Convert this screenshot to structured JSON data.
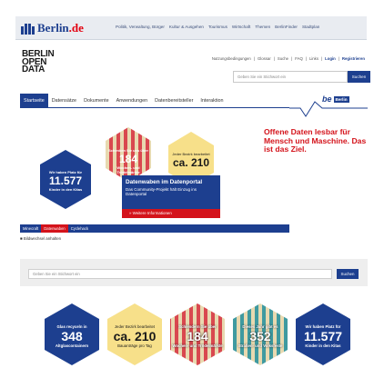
{
  "topbar": {
    "logo_text": "Berlin",
    "logo_suffix": ".de",
    "nav": [
      "Politik, Verwaltung, Bürger",
      "Kultur & Ausgehen",
      "Tourismus",
      "Wirtschaft",
      "Themen",
      "BerlinFinder",
      "Stadtplan"
    ]
  },
  "header": {
    "logo_lines": [
      "BERLIN",
      "OPEN",
      "DATA"
    ],
    "utility_links": [
      "Nutzungsbedingungen",
      "Glossar",
      "Suche",
      "FAQ",
      "Links"
    ],
    "login": "Login",
    "register": "Registrieren",
    "search_placeholder": "Geben Sie ein Stichwort ein",
    "search_button": "Suchen",
    "brand_word": "be",
    "brand_chip": "Berlin"
  },
  "mainnav": {
    "tabs": [
      "Startseite",
      "Datensätze",
      "Dokumente",
      "Anwendungen",
      "Datenbereitsteller",
      "Interaktion"
    ]
  },
  "claim": "Offene Daten lesbar für Mensch und Maschine. Das ist das Ziel.",
  "hero": {
    "kitas": {
      "pre": "Wir haben Platz für",
      "value": "11.577",
      "post": "Kinder in den Kitas"
    },
    "markets": {
      "pre": "Schenken Sie uns über",
      "value": "184",
      "post": "Wochen- und Trödelmärkte"
    },
    "district": {
      "pre": "Jeder Bezirk bearbeitet",
      "value": "ca. 210",
      "post": ""
    }
  },
  "portal": {
    "title": "Datenwaben im Datenportal",
    "text": "Das Community-Projekt hält Einzug ins Datenportal",
    "more": "» Weitere Informationen"
  },
  "slider": {
    "tabs": [
      "Minecraft",
      "Datenwaben",
      "Cyclehack"
    ],
    "change": "Bildwechsel anhalten"
  },
  "band": {
    "placeholder": "Geben Sie ein Stichwort ein",
    "button": "Suchen"
  },
  "honeycomb": [
    {
      "pre": "Glas recyceln in",
      "value": "348",
      "post": "Altglascontainern",
      "style": "navy"
    },
    {
      "pre": "Jeder Bezirk bearbeitet",
      "value": "ca. 210",
      "post": "Bauanträge pro Tag",
      "style": "yellow"
    },
    {
      "pre": "Schlendern Sie über",
      "value": "184",
      "post": "Wochen- und Trödelmärkte",
      "style": "stripe"
    },
    {
      "pre": "Dieses Jahr gibt es",
      "value": "352",
      "post": "Straßen- und Volksfeste",
      "style": "stripe"
    },
    {
      "pre": "Wir haben Platz für",
      "value": "11.577",
      "post": "Kinder in den Kitas",
      "style": "navy"
    }
  ],
  "colors": {
    "navy": "#1d3f8f",
    "red": "#d4131b",
    "yellow": "#f7e08a",
    "stripe_red": "#d9484f",
    "stripe_teal": "#3f9aa0"
  }
}
